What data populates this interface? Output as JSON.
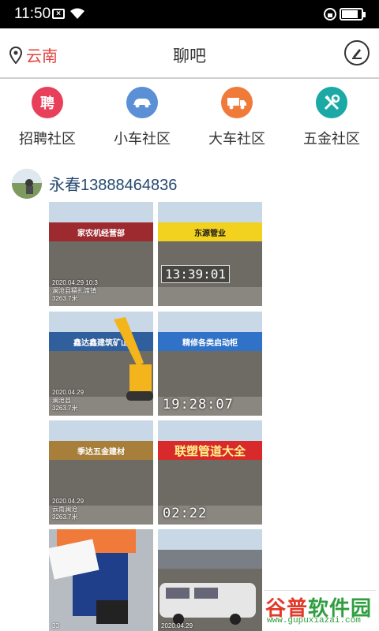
{
  "status_bar": {
    "time": "11:50",
    "battery_level": 0.85
  },
  "header": {
    "location": "云南",
    "title": "聊吧"
  },
  "categories": [
    {
      "label": "招聘社区",
      "icon": "hire-icon",
      "glyph": "聘",
      "color": "#e8405a"
    },
    {
      "label": "小车社区",
      "icon": "car-icon",
      "glyph": "",
      "color": "#5b8fd6"
    },
    {
      "label": "大车社区",
      "icon": "truck-icon",
      "glyph": "",
      "color": "#f07a3a"
    },
    {
      "label": "五金社区",
      "icon": "tools-icon",
      "glyph": "",
      "color": "#1aa9a4"
    }
  ],
  "post": {
    "user_name": "永春13888464836",
    "photos": [
      {
        "sign": "家农机经营部",
        "sign_color": "#9c2a2e",
        "overlay": "2020.04.29 10:3\n澜沧县糯扎渡镇\n3263.7米"
      },
      {
        "sign": "东源管业",
        "sign_color": "#f2d21f",
        "overlay": "13:39:01"
      },
      {
        "sign": "鑫达鑫建筑矿山",
        "sign_color": "#2f5f9c",
        "overlay": "2020.04.29\n澜沧县\n3263.7米"
      },
      {
        "sign": "精修各类启动柜",
        "sign_color": "#2f72c8",
        "overlay": "19:28:07"
      },
      {
        "sign": "季达五金建材",
        "sign_color": "#a87f3a",
        "overlay": "2020.04.29\n云南澜沧\n3263.7米"
      },
      {
        "sign": "联塑管道大全",
        "sign_color": "#d82a2a",
        "overlay": "02:22"
      },
      {
        "sign": "",
        "sign_color": "#f07a3a",
        "overlay": "33"
      },
      {
        "sign": "",
        "sign_color": "#7a7f86",
        "overlay": "2020.04.29"
      }
    ]
  },
  "watermark": {
    "logo_left": "谷普",
    "logo_right": "软件园",
    "url": "www.gupuxiazai.com"
  }
}
